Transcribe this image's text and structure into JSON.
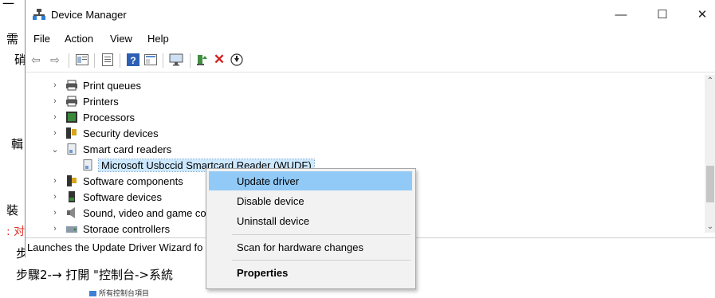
{
  "window": {
    "title": "Device Manager",
    "controls": {
      "minimize": "—",
      "maximize": "☐",
      "close": "✕"
    }
  },
  "menu": [
    "File",
    "Action",
    "View",
    "Help"
  ],
  "toolbar": {
    "icons": [
      "back-icon",
      "forward-icon",
      "properties-icon",
      "help-icon",
      "view-icon",
      "monitor-icon",
      "update-driver-icon",
      "uninstall-icon",
      "scan-icon"
    ]
  },
  "tree": {
    "items": [
      {
        "label": "Print queues",
        "state": "collapsed"
      },
      {
        "label": "Printers",
        "state": "collapsed"
      },
      {
        "label": "Processors",
        "state": "collapsed"
      },
      {
        "label": "Security devices",
        "state": "collapsed"
      },
      {
        "label": "Smart card readers",
        "state": "expanded"
      },
      {
        "label": "Microsoft Usbccid Smartcard Reader (WUDF)",
        "state": "child-selected"
      },
      {
        "label": "Software components",
        "state": "collapsed"
      },
      {
        "label": "Software devices",
        "state": "collapsed"
      },
      {
        "label": "Sound, video and game co",
        "state": "collapsed"
      },
      {
        "label": "Storage controllers",
        "state": "collapsed"
      }
    ]
  },
  "context_menu": {
    "items": [
      {
        "label": "Update driver",
        "highlighted": true
      },
      {
        "label": "Disable device"
      },
      {
        "label": "Uninstall device"
      },
      {
        "label": "Scan for hardware changes"
      },
      {
        "label": "Properties",
        "bold": true
      }
    ]
  },
  "status": {
    "text": "Launches the Update Driver Wizard fo"
  },
  "background_doc": {
    "frag_1": "需",
    "frag_2": "硝",
    "frag_3": "輯",
    "frag_4": "裝",
    "frag_5": ": 对",
    "frag_6": "步",
    "step2": "步驟2-→ 打開 \"控制台->系統",
    "small_caption": "所有控制台項目",
    "accent": "#e0352b"
  }
}
